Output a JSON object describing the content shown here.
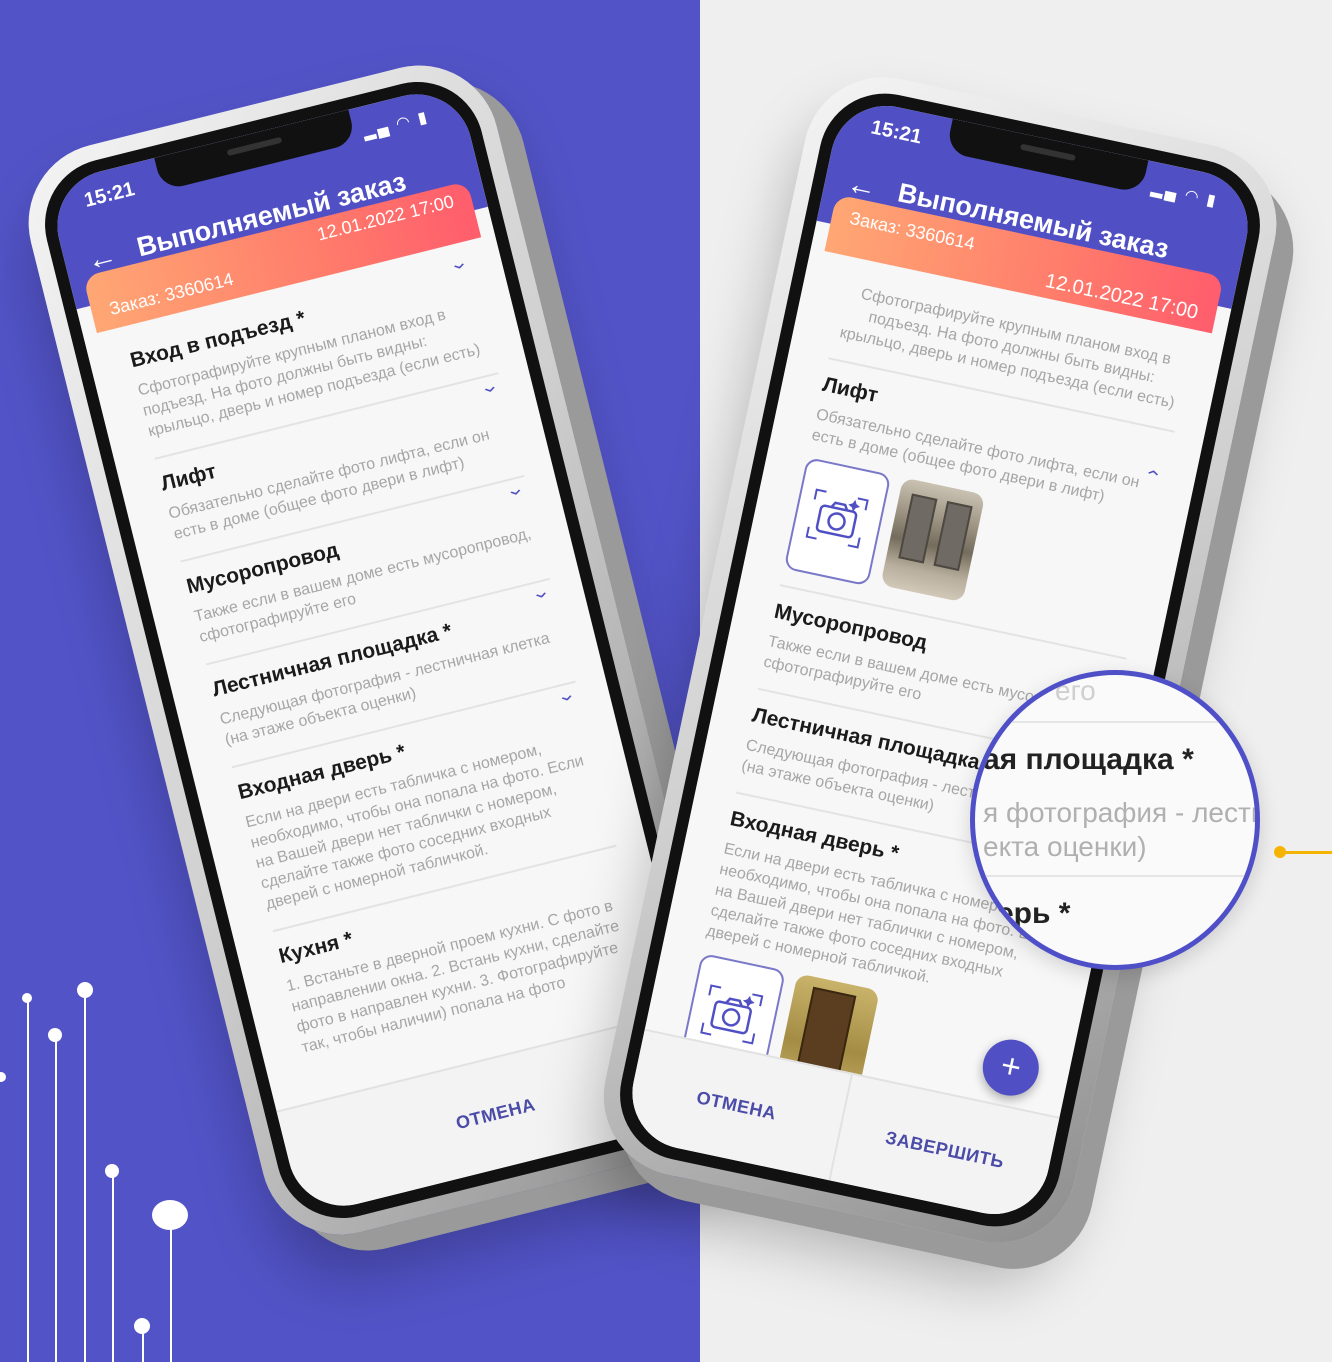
{
  "left_phone": {
    "status_time": "15:21",
    "title": "Выполняемый заказ",
    "order_number": "Заказ: 3360614",
    "order_datetime": "12.01.2022 17:00",
    "items": [
      {
        "title": "Вход в подъезд *",
        "desc": "Сфотографируйте крупным планом вход в подъезд. На фото должны быть видны: крыльцо, дверь и номер подъезда (если есть)"
      },
      {
        "title": "Лифт",
        "desc": "Обязательно сделайте фото лифта, если он есть в доме (общее фото двери в лифт)"
      },
      {
        "title": "Мусоропровод",
        "desc": "Также если в вашем доме есть мусоропровод, сфотографируйте его"
      },
      {
        "title": "Лестничная площадка *",
        "desc": "Следующая фотография - лестничная клетка (на этаже объекта оценки)"
      },
      {
        "title": "Входная дверь *",
        "desc": "Если на двери есть табличка с номером, необходимо, чтобы она попала на фото. Если на Вашей двери нет таблички с номером, сделайте также фото соседних входных дверей с номерной табличкой."
      },
      {
        "title": "Кухня *",
        "desc": "1. Встаньте в дверной проем кухни. С фото в направлении окна. 2. Встань кухни, сделайте фото в направлен кухни. 3. Фотографируйте так, чтобы наличии) попала на фото"
      }
    ],
    "cancel_label": "ОТМЕНА"
  },
  "right_phone": {
    "status_time": "15:21",
    "title": "Выполняемый заказ",
    "order_number": "Заказ: 3360614",
    "order_datetime": "12.01.2022 17:00",
    "entrance_desc": "Сфотографируйте крупным планом вход в подъезд. На фото должны быть видны: крыльцо, дверь и номер подъезда (если есть)",
    "items": [
      {
        "title": "Лифт",
        "desc": "Обязательно сделайте фото лифта, если он есть в доме (общее фото двери в лифт)"
      },
      {
        "title": "Мусоропровод",
        "desc": "Также если в вашем доме есть мусоропровод, сфотографируйте его"
      },
      {
        "title": "Лестничная площадка *",
        "desc": "Следующая фотография - лестничная клетка (на этаже объекта оценки)"
      },
      {
        "title": "Входная дверь *",
        "desc": "Если на двери есть табличка с номером, необходимо, чтобы она попала на фото. Если на Вашей двери нет таблички с номером, сделайте также фото соседних входных дверей с номерной табличкой."
      }
    ],
    "cancel_label": "ОТМЕНА",
    "finish_label": "ЗАВЕРШИТЬ",
    "fab_label": "+"
  },
  "magnifier": {
    "strike_text": "его",
    "title": "ая площадка *",
    "desc_line1": "я фотография - лестни",
    "desc_line2": "екта оценки)",
    "title2": "ерь *"
  },
  "colors": {
    "left_bg": "#5253c6",
    "right_bg": "#efefef",
    "accent": "#5050c4",
    "order_band_start": "#ffa774",
    "order_band_end": "#ff5d6c",
    "pointer": "#f5b400"
  }
}
